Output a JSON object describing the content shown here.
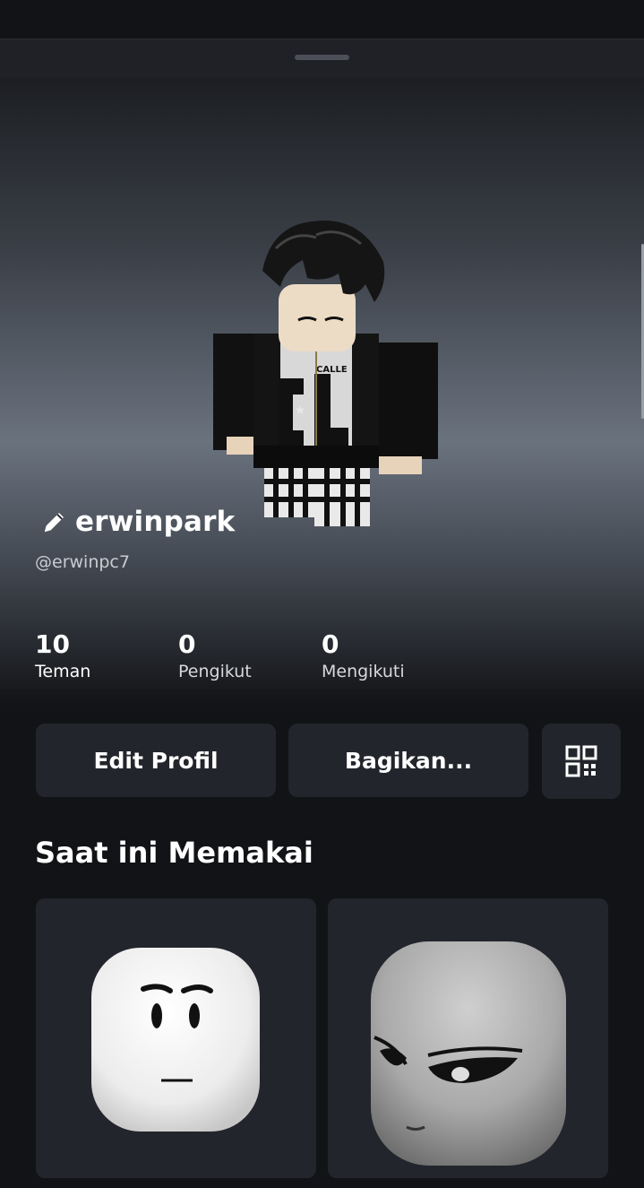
{
  "profile": {
    "display_name": "erwinpark",
    "username": "@erwinpc7"
  },
  "stats": [
    {
      "value": "10",
      "label": "Teman"
    },
    {
      "value": "0",
      "label": "Pengikut"
    },
    {
      "value": "0",
      "label": "Mengikuti"
    }
  ],
  "actions": {
    "edit_label": "Edit Profil",
    "share_label": "Bagikan...",
    "qr_icon": "qr-code-icon"
  },
  "wearing": {
    "title": "Saat ini Memakai",
    "items": [
      {
        "icon": "classic-face-head"
      },
      {
        "icon": "smirk-face-head"
      }
    ]
  },
  "colors": {
    "background": "#121316",
    "card": "#23252c",
    "text": "#ffffff",
    "muted": "#c9ccd1"
  }
}
